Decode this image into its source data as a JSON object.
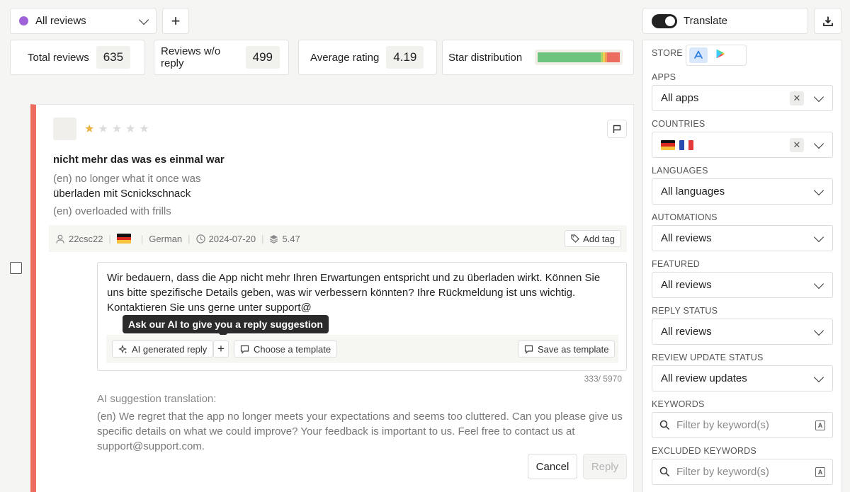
{
  "filter_bar": {
    "view_label": "All reviews",
    "add_label": "+"
  },
  "stats": {
    "total_label": "Total reviews",
    "total_value": "635",
    "noreply_label": "Reviews w/o reply",
    "noreply_value": "499",
    "avg_label": "Average rating",
    "avg_value": "4.19",
    "dist_label": "Star distribution",
    "distribution_colors": [
      "#6cc47e",
      "#a9d46a",
      "#f3cb4e",
      "#f29d56",
      "#ec6d5f"
    ]
  },
  "review": {
    "rating": 1,
    "stars": [
      "★",
      "★",
      "★",
      "★",
      "★"
    ],
    "title": "nicht mehr das was es einmal war",
    "title_translation": "(en) no longer what it once was",
    "body": "überladen mit Scnickschnack",
    "body_translation": "(en) overloaded with frills",
    "meta": {
      "user": "22csc22",
      "language": "German",
      "date": "2024-07-20",
      "version": "5.47"
    },
    "add_tag_label": "Add tag",
    "reply_text": "Wir bedauern, dass die App nicht mehr Ihren Erwartungen entspricht und zu überladen wirkt. Können Sie uns bitte spezifische Details geben, was wir verbessern könnten? Ihre Rückmeldung ist uns wichtig. Kontaktieren Sie uns gerne unter support@",
    "tooltip": "Ask our AI to give you a reply suggestion",
    "ai_reply_label": "AI generated reply",
    "template_label": "Choose a template",
    "save_template_label": "Save as template",
    "char_count": "333/ 5970",
    "ai_translation_label": "AI suggestion translation:",
    "ai_translation": "(en) We regret that the app no longer meets your expectations and seems too cluttered. Can you please give us specific details on what we could improve? Your feedback is important to us. Feel free to contact us at support@support.com.",
    "cancel_label": "Cancel",
    "reply_label": "Reply"
  },
  "sidebar": {
    "translate_label": "Translate",
    "store_label": "STORE",
    "apps_label": "APPS",
    "apps_value": "All apps",
    "countries_label": "COUNTRIES",
    "languages_label": "LANGUAGES",
    "languages_value": "All languages",
    "automations_label": "AUTOMATIONS",
    "automations_value": "All reviews",
    "featured_label": "FEATURED",
    "featured_value": "All reviews",
    "reply_status_label": "REPLY STATUS",
    "reply_status_value": "All reviews",
    "update_status_label": "REVIEW UPDATE STATUS",
    "update_status_value": "All review updates",
    "keywords_label": "KEYWORDS",
    "keywords_placeholder": "Filter by keyword(s)",
    "excluded_label": "EXCLUDED KEYWORDS",
    "excluded_placeholder": "Filter by keyword(s)"
  }
}
